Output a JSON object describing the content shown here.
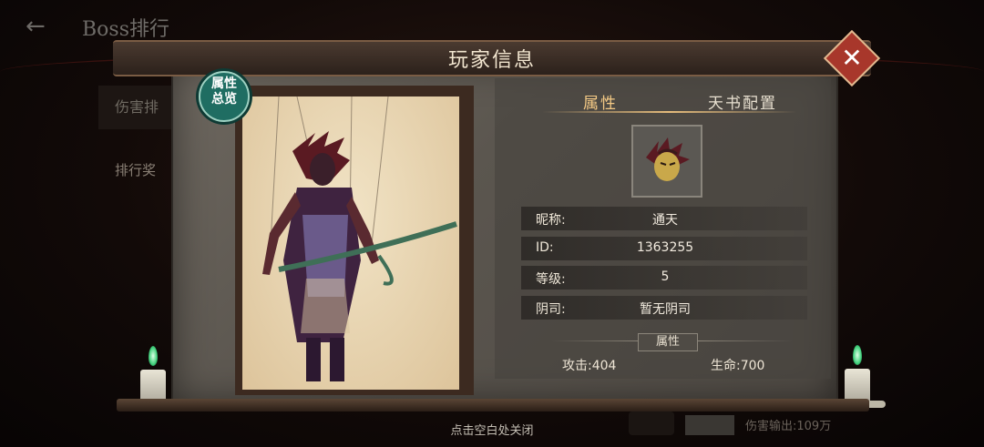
{
  "background": {
    "title": "Boss排行",
    "tab_label": "伤害排",
    "rank_label": "排行奖",
    "damage_output": "伤害输出:109万"
  },
  "hint": "点击空白处关闭",
  "dialog": {
    "title": "玩家信息",
    "badge": {
      "line1": "属性",
      "line2": "总览"
    },
    "tabs": [
      {
        "label": "属性",
        "active": true
      },
      {
        "label": "天书配置",
        "active": false
      }
    ],
    "info_rows": [
      {
        "label": "昵称:",
        "value": "通天"
      },
      {
        "label": "ID:",
        "value": "1363255"
      },
      {
        "label": "等级:",
        "value": "5"
      },
      {
        "label": "阴司:",
        "value": "暂无阴司"
      }
    ],
    "attr_section_label": "属性",
    "stats": {
      "attack": "攻击:404",
      "hp": "生命:700"
    }
  },
  "colors": {
    "accent": "#f4c985",
    "close_button": "#a8372b",
    "badge": "#1f6d62",
    "candle_flame": "#3fd07b"
  }
}
